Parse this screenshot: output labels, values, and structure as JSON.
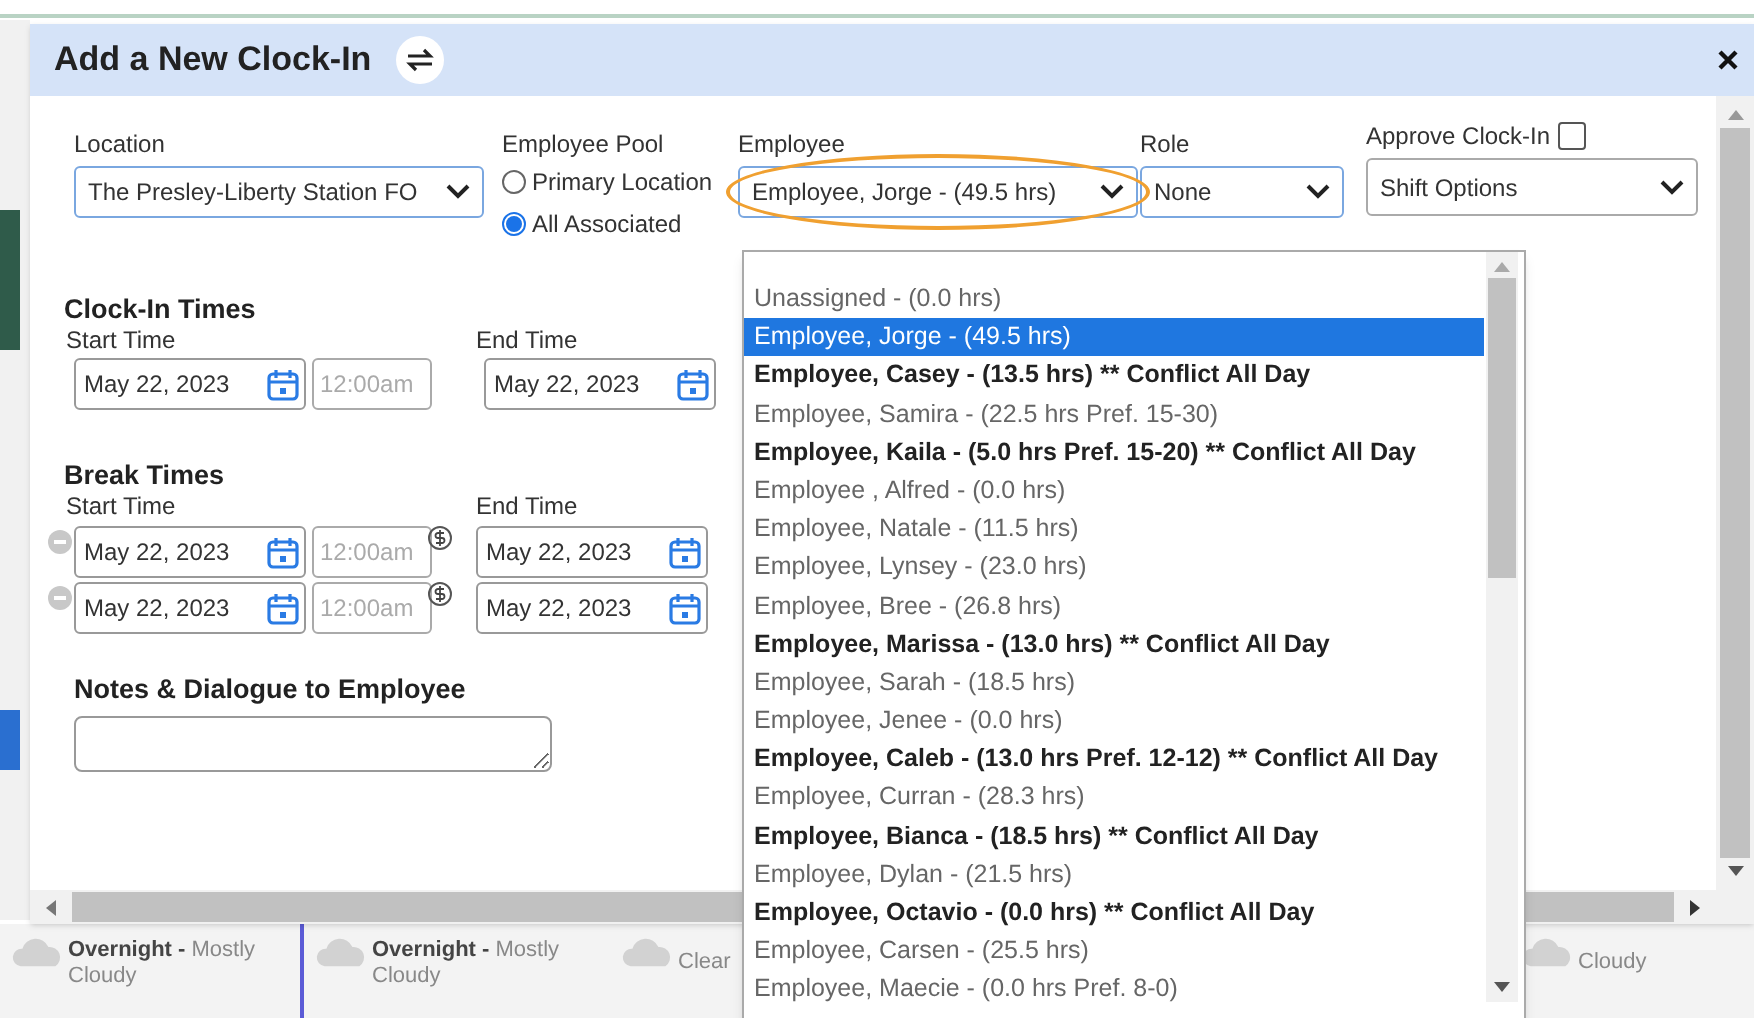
{
  "window": {
    "title": "Add a New Clock-In"
  },
  "form": {
    "location": {
      "label": "Location",
      "value": "The Presley-Liberty Station FO"
    },
    "employee_pool": {
      "label": "Employee Pool",
      "options": [
        {
          "label": "Primary Location",
          "selected": false
        },
        {
          "label": "All Associated",
          "selected": true
        }
      ]
    },
    "employee": {
      "label": "Employee",
      "value": "Employee, Jorge - (49.5 hrs)",
      "circled": true
    },
    "role": {
      "label": "Role",
      "value": "None"
    },
    "approve": {
      "label": "Approve Clock-In",
      "checked": false
    },
    "shift_options": {
      "value": "Shift Options"
    },
    "clock_in": {
      "title": "Clock-In Times",
      "start_label": "Start Time",
      "end_label": "End Time",
      "start_date": "May 22, 2023",
      "start_time_placeholder": "12:00am",
      "end_date": "May 22, 2023"
    },
    "breaks": {
      "title": "Break Times",
      "start_label": "Start Time",
      "end_label": "End Time",
      "rows": [
        {
          "start_date": "May 22, 2023",
          "start_time_placeholder": "12:00am",
          "end_date": "May 22, 2023"
        },
        {
          "start_date": "May 22, 2023",
          "start_time_placeholder": "12:00am",
          "end_date": "May 22, 2023"
        }
      ]
    },
    "notes": {
      "label": "Notes & Dialogue to Employee"
    }
  },
  "employee_dropdown": {
    "items": [
      {
        "label": "Unassigned - (0.0 hrs)",
        "selected": false,
        "conflict": false
      },
      {
        "label": "Employee, Jorge - (49.5 hrs)",
        "selected": true,
        "conflict": false
      },
      {
        "label": "Employee, Casey - (13.5 hrs) ** Conflict All Day",
        "selected": false,
        "conflict": true
      },
      {
        "label": "Employee, Samira - (22.5 hrs Pref. 15-30)",
        "selected": false,
        "conflict": false
      },
      {
        "label": "Employee, Kaila - (5.0 hrs Pref. 15-20) ** Conflict All Day",
        "selected": false,
        "conflict": true
      },
      {
        "label": "Employee , Alfred - (0.0 hrs)",
        "selected": false,
        "conflict": false
      },
      {
        "label": "Employee, Natale - (11.5 hrs)",
        "selected": false,
        "conflict": false
      },
      {
        "label": "Employee, Lynsey - (23.0 hrs)",
        "selected": false,
        "conflict": false
      },
      {
        "label": "Employee, Bree - (26.8 hrs)",
        "selected": false,
        "conflict": false
      },
      {
        "label": "Employee, Marissa - (13.0 hrs) ** Conflict All Day",
        "selected": false,
        "conflict": true
      },
      {
        "label": "Employee, Sarah - (18.5 hrs)",
        "selected": false,
        "conflict": false
      },
      {
        "label": "Employee, Jenee - (0.0 hrs)",
        "selected": false,
        "conflict": false
      },
      {
        "label": "Employee, Caleb - (13.0 hrs Pref. 12-12) ** Conflict All Day",
        "selected": false,
        "conflict": true
      },
      {
        "label": "Employee, Curran - (28.3 hrs)",
        "selected": false,
        "conflict": false
      },
      {
        "label": "Employee, Bianca - (18.5 hrs) ** Conflict All Day",
        "selected": false,
        "conflict": true
      },
      {
        "label": "Employee, Dylan - (21.5 hrs)",
        "selected": false,
        "conflict": false
      },
      {
        "label": "Employee, Octavio - (0.0 hrs) ** Conflict All Day",
        "selected": false,
        "conflict": true
      },
      {
        "label": "Employee, Carsen - (25.5 hrs)",
        "selected": false,
        "conflict": false
      },
      {
        "label": "Employee, Maecie - (0.0 hrs Pref. 8-0)",
        "selected": false,
        "conflict": false
      }
    ]
  },
  "background_forecasts": [
    {
      "period": "Overnight -",
      "condition": "Mostly Cloudy"
    },
    {
      "period": "Overnight -",
      "condition": "Mostly Cloudy"
    },
    {
      "condition": "Clear"
    },
    {
      "condition": "Cloudy"
    }
  ]
}
